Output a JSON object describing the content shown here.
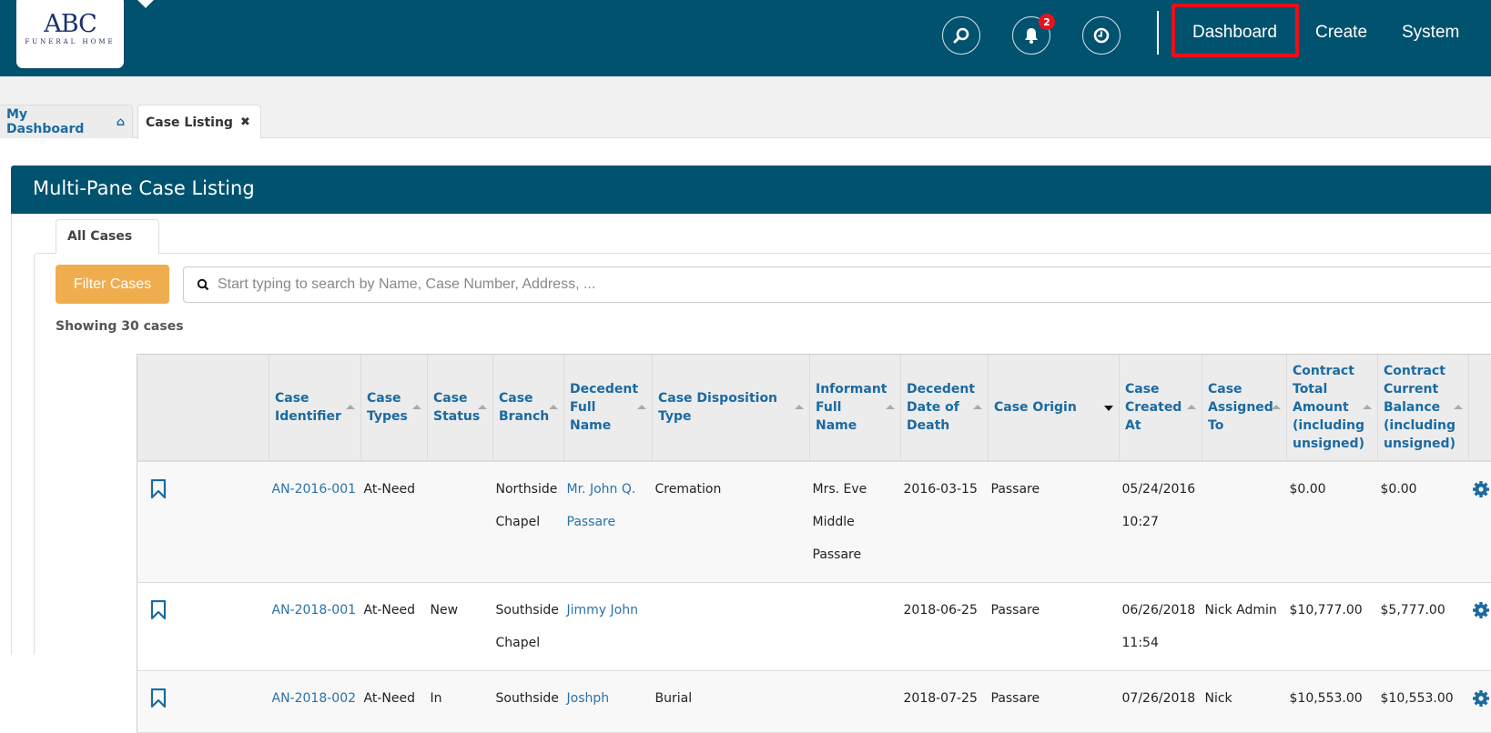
{
  "brand": {
    "logo_title": "ABC",
    "logo_subtitle": "FUNERAL HOME"
  },
  "navbar": {
    "icons": [
      {
        "name": "search-icon"
      },
      {
        "name": "bell-icon",
        "badge": "2"
      },
      {
        "name": "clock-icon"
      }
    ],
    "links": [
      "Dashboard",
      "Create",
      "System"
    ],
    "highlighted_link": "Dashboard"
  },
  "tabs": [
    {
      "label": "My Dashboard",
      "icon": "home-icon"
    },
    {
      "label": "Case Listing",
      "icon": "close-icon",
      "active": true
    }
  ],
  "panel": {
    "title": "Multi-Pane Case Listing",
    "inner_tab": "All Cases",
    "filter_button": "Filter Cases",
    "search_placeholder": "Start typing to search by Name, Case Number, Address, ...",
    "count_text": "Showing 30 cases"
  },
  "table": {
    "columns": [
      {
        "label": "",
        "sortable": false
      },
      {
        "label": "Case Identifier",
        "sortable": true
      },
      {
        "label": "Case Types",
        "sortable": true
      },
      {
        "label": "Case Status",
        "sortable": true
      },
      {
        "label": "Case Branch",
        "sortable": true
      },
      {
        "label": "Decedent Full Name",
        "sortable": true
      },
      {
        "label": "Case Disposition Type",
        "sortable": true
      },
      {
        "label": "Informant Full Name",
        "sortable": true
      },
      {
        "label": "Decedent Date of Death",
        "sortable": true
      },
      {
        "label": "Case Origin",
        "sortable": true,
        "sort": "desc"
      },
      {
        "label": "Case Created At",
        "sortable": true
      },
      {
        "label": "Case Assigned To",
        "sortable": true
      },
      {
        "label": "Contract Total Amount (including unsigned)",
        "sortable": true
      },
      {
        "label": "Contract Current Balance (including unsigned)",
        "sortable": true
      },
      {
        "label": "",
        "sortable": false
      }
    ],
    "rows": [
      {
        "case_identifier": "AN-2016-001",
        "case_types": "At-Need",
        "case_status": "",
        "case_branch": "Northside Chapel",
        "decedent": "Mr. John Q. Passare",
        "disposition": "Cremation",
        "informant": "Mrs. Eve Middle Passare",
        "date_of_death": "2016-03-15",
        "origin": "Passare",
        "created_at": "05/24/2016 10:27",
        "assigned_to": "",
        "contract_total": "$0.00",
        "contract_balance": "$0.00"
      },
      {
        "case_identifier": "AN-2018-001",
        "case_types": "At-Need",
        "case_status": "New",
        "case_branch": "Southside Chapel",
        "decedent": "Jimmy John",
        "disposition": "",
        "informant": "",
        "date_of_death": "2018-06-25",
        "origin": "Passare",
        "created_at": "06/26/2018 11:54",
        "assigned_to": "Nick Admin",
        "contract_total": "$10,777.00",
        "contract_balance": "$5,777.00"
      },
      {
        "case_identifier": "AN-2018-002",
        "case_types": "At-Need",
        "case_status": "In",
        "case_branch": "Southside",
        "decedent": "Joshph",
        "disposition": "Burial",
        "informant": "",
        "date_of_death": "2018-07-25",
        "origin": "Passare",
        "created_at": "07/26/2018",
        "assigned_to": "Nick",
        "contract_total": "$10,553.00",
        "contract_balance": "$10,553.00"
      }
    ]
  },
  "colors": {
    "primary": "#00526f",
    "link": "#1b6aa1",
    "warning": "#f0ad4e",
    "badge": "#e3141f",
    "highlight_box": "#e8101a"
  }
}
